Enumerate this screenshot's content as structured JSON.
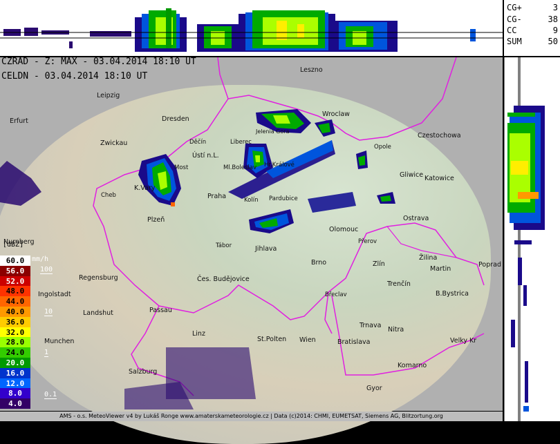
{
  "header": {
    "line1": "CZRAD - Z: MAX - 03.04.2014 18:10 UT",
    "line2": "CELDN - 03.04.2014 18:10 UT"
  },
  "stats": [
    {
      "key": "CG+",
      "value": "3"
    },
    {
      "key": "CG-",
      "value": "38"
    },
    {
      "key": "CC",
      "value": "9"
    },
    {
      "key": "SUM",
      "value": "50"
    }
  ],
  "legend": {
    "unit_label": "[dBZ]",
    "rain_unit_label": "mm/h",
    "levels": [
      {
        "label": "60.0",
        "color": "#ffffff"
      },
      {
        "label": "56.0",
        "color": "#8b0000"
      },
      {
        "label": "52.0",
        "color": "#cc0000"
      },
      {
        "label": "48.0",
        "color": "#ff3300"
      },
      {
        "label": "44.0",
        "color": "#ff6600"
      },
      {
        "label": "40.0",
        "color": "#ff9900"
      },
      {
        "label": "36.0",
        "color": "#ffcc00"
      },
      {
        "label": "32.0",
        "color": "#ffff00"
      },
      {
        "label": "28.0",
        "color": "#99ff00"
      },
      {
        "label": "24.0",
        "color": "#33cc00"
      },
      {
        "label": "20.0",
        "color": "#009900"
      },
      {
        "label": "16.0",
        "color": "#0033cc"
      },
      {
        "label": "12.0",
        "color": "#0066ff"
      },
      {
        "label": "8.0",
        "color": "#3300cc"
      },
      {
        "label": "4.0",
        "color": "#330066"
      }
    ],
    "rain_rates": [
      "100",
      "10",
      "1",
      "0.1"
    ]
  },
  "cities": [
    {
      "name": "Leszno"
    },
    {
      "name": "Leipzig"
    },
    {
      "name": "Dresden"
    },
    {
      "name": "Wroclaw"
    },
    {
      "name": "Erfurt"
    },
    {
      "name": "Jelenia Gora"
    },
    {
      "name": "Czestochowa"
    },
    {
      "name": "Zwickau"
    },
    {
      "name": "Děčín"
    },
    {
      "name": "Liberec"
    },
    {
      "name": "Opole"
    },
    {
      "name": "Ústí n.L."
    },
    {
      "name": "Most"
    },
    {
      "name": "Ml.Boleslav"
    },
    {
      "name": "Hr.Králové"
    },
    {
      "name": "Gliwice"
    },
    {
      "name": "Katowice"
    },
    {
      "name": "K.Vary"
    },
    {
      "name": "Cheb"
    },
    {
      "name": "Praha"
    },
    {
      "name": "Kolín"
    },
    {
      "name": "Pardubice"
    },
    {
      "name": "Plzeň"
    },
    {
      "name": "Ostrava"
    },
    {
      "name": "Olomouc"
    },
    {
      "name": "Nurnberg"
    },
    {
      "name": "Tábor"
    },
    {
      "name": "Jihlava"
    },
    {
      "name": "Přerov"
    },
    {
      "name": "Žilina"
    },
    {
      "name": "Brno"
    },
    {
      "name": "Zlín"
    },
    {
      "name": "Martin"
    },
    {
      "name": "Poprad"
    },
    {
      "name": "Regensburg"
    },
    {
      "name": "Čes. Budějovice"
    },
    {
      "name": "Trenčín"
    },
    {
      "name": "Ingolstadt"
    },
    {
      "name": "Břeclav"
    },
    {
      "name": "B.Bystrica"
    },
    {
      "name": "Passau"
    },
    {
      "name": "Landshut"
    },
    {
      "name": "Trnava"
    },
    {
      "name": "Nitra"
    },
    {
      "name": "Linz"
    },
    {
      "name": "St.Polten"
    },
    {
      "name": "Wien"
    },
    {
      "name": "Munchen"
    },
    {
      "name": "Bratislava"
    },
    {
      "name": "Velky Kr"
    },
    {
      "name": "Komarno"
    },
    {
      "name": "Salzburg"
    },
    {
      "name": "Gyor"
    }
  ],
  "footer": "AMS - o.s. MeteoViewer v4 by Lukáš Ronge www.amaterskameteorologie.cz | Data (c)2014: CHMI, EUMETSAT, Siemens AG, Blitzortung.org"
}
